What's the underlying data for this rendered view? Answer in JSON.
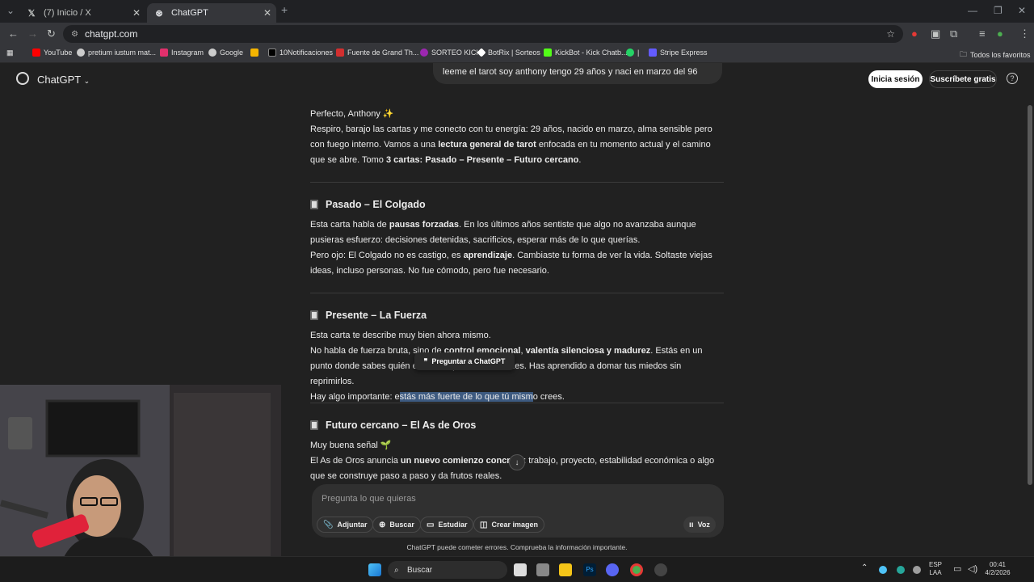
{
  "browser": {
    "tabs": [
      {
        "label": "(7) Inicio / X",
        "icon": "x-logo-icon"
      },
      {
        "label": "ChatGPT",
        "icon": "chatgpt-icon"
      }
    ],
    "url": "chatgpt.com",
    "bookmarks": [
      {
        "label": "YouTube",
        "color": "#ff0000"
      },
      {
        "label": "pretium iustum mat...",
        "color": "#cccccc"
      },
      {
        "label": "Instagram",
        "color": "#e1306c"
      },
      {
        "label": "Google",
        "color": "#cccccc"
      },
      {
        "label": "",
        "color": "#f4b400"
      },
      {
        "label": "10Notificaciones",
        "color": "#000000"
      },
      {
        "label": "Fuente de Grand Th...",
        "color": "#d32f2f"
      },
      {
        "label": "SORTEO KICK",
        "color": "#9c27b0"
      },
      {
        "label": "BotRix | Sorteos",
        "color": "#ffffff"
      },
      {
        "label": "KickBot - Kick Chatb...",
        "color": "#53fc18"
      },
      {
        "label": "|",
        "color": "#25d366"
      },
      {
        "label": "Stripe Express",
        "color": "#635bff"
      }
    ],
    "all_bookmarks": "Todos los favoritos"
  },
  "header": {
    "title": "ChatGPT",
    "login_label": "Inicia sesión",
    "subscribe_label": "Suscríbete gratis",
    "help": "?"
  },
  "user_message": "leeme el tarot soy anthony tengo 29 años y naci en marzo del 96",
  "reply": {
    "intro_1": "Perfecto, Anthony ✨",
    "intro_2a": "Respiro, barajo las cartas y me conecto con tu energía: 29 años, nacido en marzo, alma sensible pero con fuego interno. Vamos a una ",
    "intro_2b": "lectura general de tarot",
    "intro_2c": " enfocada en tu momento actual y el camino que se abre. Tomo ",
    "intro_2d": "3 cartas: Pasado – Presente – Futuro cercano",
    "intro_2e": ".",
    "pasado_title": "Pasado – El Colgado",
    "pasado_1a": "Esta carta habla de ",
    "pasado_1b": "pausas forzadas",
    "pasado_1c": ". En los últimos años sentiste que algo no avanzaba aunque pusieras esfuerzo: decisiones detenidas, sacrificios, esperar más de lo que querías.",
    "pasado_2a": "Pero ojo: El Colgado no es castigo, es ",
    "pasado_2b": "aprendizaje",
    "pasado_2c": ". Cambiaste tu forma de ver la vida. Soltaste viejas ideas, incluso personas. No fue cómodo, pero fue necesario.",
    "presente_title": "Presente – La Fuerza",
    "presente_1": "Esta carta te describe muy bien ahora mismo.",
    "presente_2a": "No habla de fuerza bruta, sino de ",
    "presente_2b": "control emocional",
    "presente_2c": ", ",
    "presente_2d": "valentía silenciosa y madurez",
    "presente_2e": ". Estás en un punto donde sabes quién eres, aunque a veces dudes. Has aprendido a domar tus miedos sin reprimirlos.",
    "presente_3a": "Hay algo importante: e",
    "presente_3b": "stás más fuerte de lo que tú mism",
    "presente_3c": "o crees.",
    "futuro_title": "Futuro cercano – El As de Oros",
    "futuro_1": "Muy buena señal 🌱",
    "futuro_2a": "El As de Oros anuncia ",
    "futuro_2b": "un nuevo comienzo concreto",
    "futuro_2c": ": trabajo, proyecto, estabilidad económica o algo que se construye paso a paso y da frutos reales."
  },
  "tooltip": "Preguntar a ChatGPT",
  "composer": {
    "placeholder": "Pregunta lo que quieras",
    "attach": "Adjuntar",
    "search": "Buscar",
    "study": "Estudiar",
    "image": "Crear imagen",
    "voice": "Voz"
  },
  "disclaimer": "ChatGPT puede cometer errores. Comprueba la información importante.",
  "taskbar": {
    "search": "Buscar",
    "lang_1": "ESP",
    "lang_2": "LAA",
    "time": "00:41",
    "date": "4/2/2026"
  }
}
